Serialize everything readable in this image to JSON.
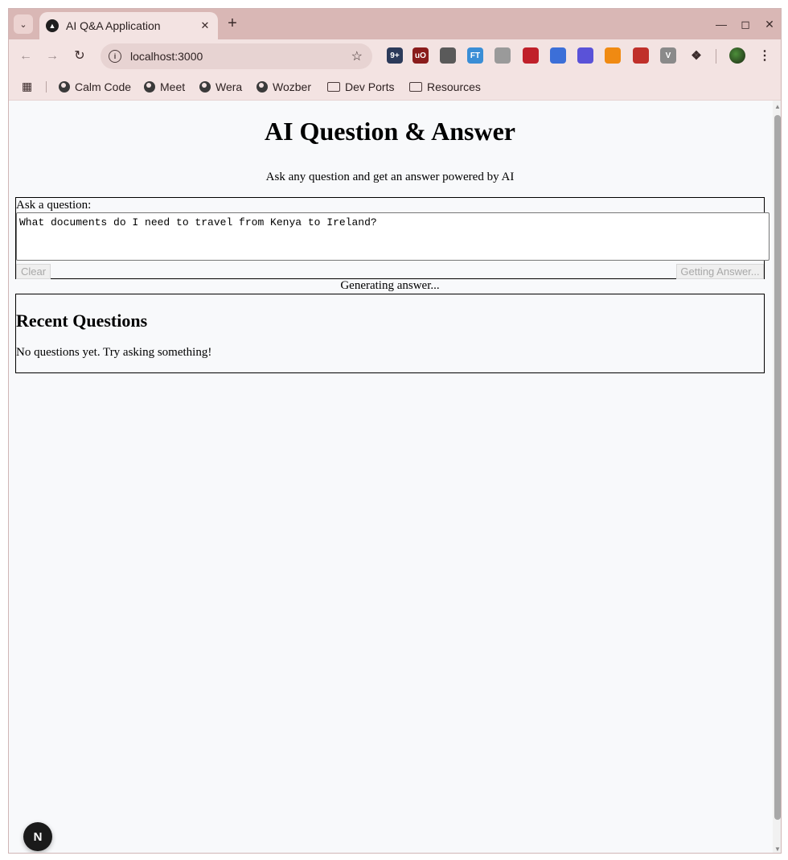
{
  "browser": {
    "tab": {
      "title": "AI Q&A Application"
    },
    "address": {
      "url": "localhost:3000"
    },
    "extensions": [
      {
        "name": "extension-badge",
        "label": "9+",
        "color": "#2b3a5a"
      },
      {
        "name": "ublock",
        "label": "uO",
        "color": "#8a1c1c"
      },
      {
        "name": "extension-mountain",
        "label": "",
        "color": "#5a5a5a"
      },
      {
        "name": "extension-ft",
        "label": "FT",
        "color": "#3a8ed6"
      },
      {
        "name": "extension-mail",
        "label": "",
        "color": "#9a9a9a"
      },
      {
        "name": "extension-pen",
        "label": "",
        "color": "#c0202a"
      },
      {
        "name": "extension-translate",
        "label": "",
        "color": "#3c6fd8"
      },
      {
        "name": "extension-gear",
        "label": "",
        "color": "#5a52d8"
      },
      {
        "name": "extension-rss",
        "label": "",
        "color": "#f08a12"
      },
      {
        "name": "extension-dev",
        "label": "",
        "color": "#c0302a"
      },
      {
        "name": "extension-v",
        "label": "V",
        "color": "#8a8a8a"
      }
    ],
    "bookmarks": [
      {
        "label": "Calm Code",
        "kind": "globe"
      },
      {
        "label": "Meet",
        "kind": "globe"
      },
      {
        "label": "Wera",
        "kind": "globe"
      },
      {
        "label": "Wozber",
        "kind": "globe"
      },
      {
        "label": "Dev Ports",
        "kind": "folder"
      },
      {
        "label": "Resources",
        "kind": "folder"
      }
    ]
  },
  "page": {
    "title": "AI Question & Answer",
    "subtitle": "Ask any question and get an answer powered by AI",
    "form": {
      "label": "Ask a question:",
      "question_value": "What documents do I need to travel from Kenya to Ireland?",
      "clear_label": "Clear",
      "submit_label": "Getting Answer..."
    },
    "status": "Generating answer...",
    "recent": {
      "title": "Recent Questions",
      "empty_text": "No questions yet. Try asking something!"
    },
    "dev_badge": "N"
  }
}
